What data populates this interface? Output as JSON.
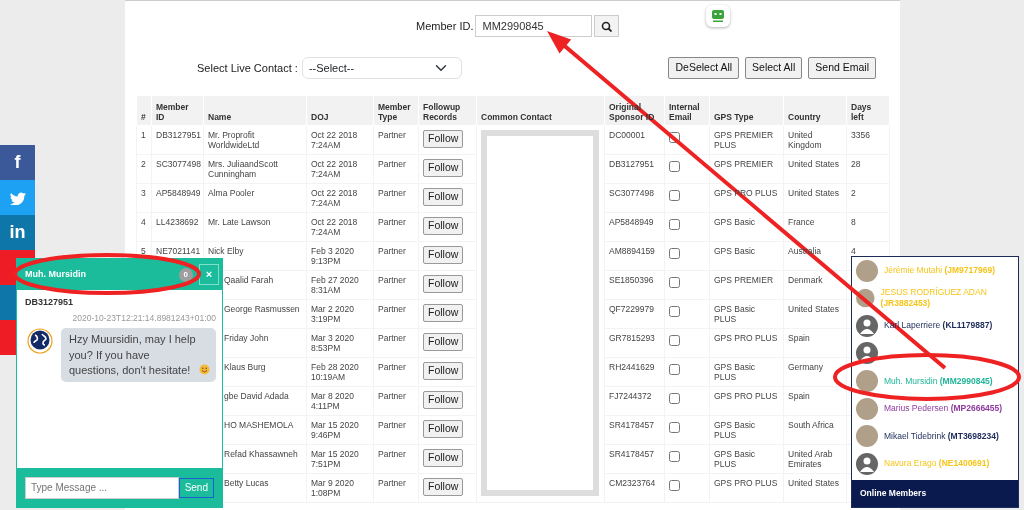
{
  "search": {
    "label": "Member ID.",
    "value": "MM2990845"
  },
  "live_contact": {
    "label": "Select Live Contact :",
    "value": "--Select--"
  },
  "actions": [
    "DeSelect All",
    "Select All",
    "Send Email"
  ],
  "table": {
    "columns": [
      "#",
      "Member ID",
      "Name",
      "DOJ",
      "Member Type",
      "Followup Records",
      "Common Contact",
      "Original Sponsor ID",
      "Internal Email",
      "GPS Type",
      "Country",
      "Days left"
    ],
    "rows": [
      {
        "number": "1",
        "member_id": "DB3127951",
        "name": "Mr. Proprofit WorldwideLtd",
        "doj": "Oct 22 2018 7:24AM",
        "member_type": "Partner",
        "follow": "Follow",
        "sponsor": "DC00001",
        "checked": false,
        "gps": "GPS PREMIER PLUS",
        "country": "United Kingdom",
        "days": "3356"
      },
      {
        "number": "2",
        "member_id": "SC3077498",
        "name": "Mrs. JuliaandScott Cunningham",
        "doj": "Oct 22 2018 7:24AM",
        "member_type": "Partner",
        "follow": "Follow",
        "sponsor": "DB3127951",
        "checked": false,
        "gps": "GPS PREMIER",
        "country": "United States",
        "days": "28"
      },
      {
        "number": "3",
        "member_id": "AP5848949",
        "name": "Alma Pooler",
        "doj": "Oct 22 2018 7:24AM",
        "member_type": "Partner",
        "follow": "Follow",
        "sponsor": "SC3077498",
        "checked": false,
        "gps": "GPS PRO PLUS",
        "country": "United States",
        "days": "2"
      },
      {
        "number": "4",
        "member_id": "LL4238692",
        "name": "Mr. Late Lawson",
        "doj": "Oct 22 2018 7:24AM",
        "member_type": "Partner",
        "follow": "Follow",
        "sponsor": "AP5848949",
        "checked": false,
        "gps": "GPS Basic",
        "country": "France",
        "days": "8"
      },
      {
        "number": "5",
        "member_id": "NE7021141",
        "name": "Nick Elby",
        "doj": "Feb 3 2020 9:13PM",
        "member_type": "Partner",
        "follow": "Follow",
        "sponsor": "AM8894159",
        "checked": false,
        "gps": "GPS Basic",
        "country": "Australia",
        "days": "4"
      },
      {
        "name": "Qaalid Farah",
        "doj": "Feb 27 2020 8:31AM",
        "member_type": "Partner",
        "follow": "Follow",
        "sponsor": "SE1850396",
        "checked": false,
        "gps": "GPS PREMIER",
        "country": "Denmark"
      },
      {
        "name": "George Rasmussen",
        "doj": "Mar 2 2020 3:19PM",
        "member_type": "Partner",
        "follow": "Follow",
        "sponsor": "QF7229979",
        "checked": false,
        "gps": "GPS Basic PLUS",
        "country": "United States"
      },
      {
        "name": "Friday John",
        "doj": "Mar 3 2020 8:53PM",
        "member_type": "Partner",
        "follow": "Follow",
        "sponsor": "GR7815293",
        "checked": false,
        "gps": "GPS PRO PLUS",
        "country": "Spain"
      },
      {
        "name": "Klaus Burg",
        "doj": "Feb 28 2020 10:19AM",
        "member_type": "Partner",
        "follow": "Follow",
        "sponsor": "RH2441629",
        "checked": false,
        "gps": "GPS Basic PLUS",
        "country": "Germany"
      },
      {
        "name": "gbe David Adada",
        "doj": "Mar 8 2020 4:11PM",
        "member_type": "Partner",
        "follow": "Follow",
        "sponsor": "FJ7244372",
        "checked": false,
        "gps": "GPS PRO PLUS",
        "country": "Spain"
      },
      {
        "name": "HO MASHEMOLA",
        "doj": "Mar 15 2020 9:46PM",
        "member_type": "Partner",
        "follow": "Follow",
        "sponsor": "SR4178457",
        "checked": false,
        "gps": "GPS Basic PLUS",
        "country": "South Africa"
      },
      {
        "name": "Refad Khassawneh",
        "doj": "Mar 15 2020 7:51PM",
        "member_type": "Partner",
        "follow": "Follow",
        "sponsor": "SR4178457",
        "checked": false,
        "gps": "GPS Basic PLUS",
        "country": "United Arab Emirates"
      },
      {
        "name": "Betty Lucas",
        "doj": "Mar 9 2020 1:08PM",
        "member_type": "Partner",
        "follow": "Follow",
        "sponsor": "CM2323764",
        "checked": false,
        "gps": "GPS PRO PLUS",
        "country": "United States"
      }
    ]
  },
  "social": [
    {
      "kind": "facebook",
      "color": "#3b5998",
      "glyph": "f"
    },
    {
      "kind": "twitter",
      "color": "#1da1f2"
    },
    {
      "kind": "linkedin",
      "color": "#0e76a8",
      "glyph": "in"
    },
    {
      "kind": "plain",
      "color": "#ee1c25"
    },
    {
      "kind": "plain",
      "color": "#0e76a8"
    },
    {
      "kind": "plain",
      "color": "#ee1c25"
    }
  ],
  "chat": {
    "title": "Muh. Mursidin",
    "unread": "0",
    "close": "×",
    "member_id": "DB3127951",
    "timestamp": "2020-10-23T12:21:14.8981243+01:00",
    "message": "Hzy Muursidin, may I help you? If you have questions, don't hesitate!",
    "placeholder": "Type Message ...",
    "send": "Send"
  },
  "online_members": {
    "title": "Online Members",
    "items": [
      {
        "kind": "photo",
        "name": "Jérémie Mutahi **(JM9717969)**",
        "color": "#f5c518"
      },
      {
        "kind": "photo",
        "name": "JESUS RODRÍGUEZ ADAN **(JR3882453)**",
        "color": "#f5c518"
      },
      {
        "kind": "silhouette",
        "name": "Karl Laperriere **(KL1179887)**",
        "color": "#1d2b5a"
      },
      {
        "kind": "silhouette"
      },
      {
        "kind": "photo",
        "name": "Muh. Mursidin **(MM2990845)**",
        "color": "#1fb597"
      },
      {
        "kind": "photo",
        "name": "Marius Pedersen **(MP2666455)**",
        "color": "#8e3a9e"
      },
      {
        "kind": "photo",
        "name": "Mikael Tidebrink **(MT3698234)**",
        "color": "#1d2b5a"
      },
      {
        "kind": "silhouette",
        "name": "Navura Erago **(NE1400691)**",
        "color": "#f5c518"
      }
    ]
  }
}
